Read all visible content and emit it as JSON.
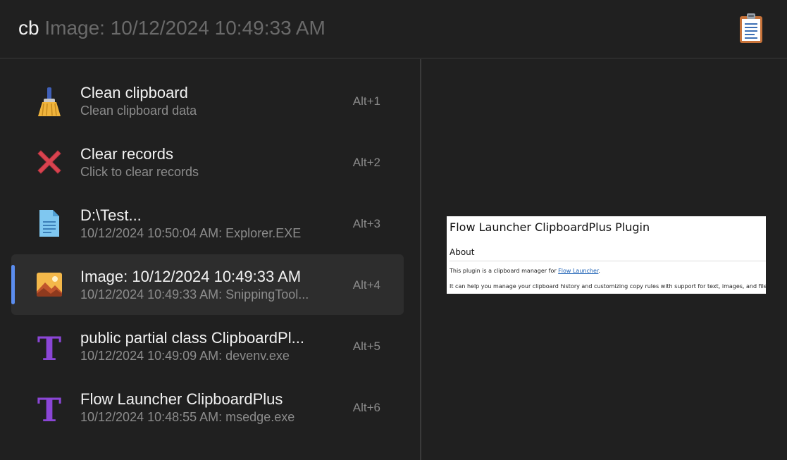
{
  "search": {
    "query": "cb",
    "suggestion": " Image: 10/12/2024 10:49:33 AM"
  },
  "plugin": {
    "icon": "clipboard-icon"
  },
  "results": [
    {
      "title": "Clean clipboard",
      "subtitle": "Clean clipboard data",
      "hotkey": "Alt+1",
      "icon": "broom-icon"
    },
    {
      "title": "Clear records",
      "subtitle": "Click to clear records",
      "hotkey": "Alt+2",
      "icon": "red-x-icon"
    },
    {
      "title": "D:\\Test...",
      "subtitle": "10/12/2024 10:50:04 AM: Explorer.EXE",
      "hotkey": "Alt+3",
      "icon": "file-icon"
    },
    {
      "title": "Image: 10/12/2024 10:49:33 AM",
      "subtitle": "10/12/2024 10:49:33 AM: SnippingTool...",
      "hotkey": "Alt+4",
      "icon": "image-icon",
      "selected": true
    },
    {
      "title": "public partial class ClipboardPl...",
      "subtitle": "10/12/2024 10:49:09 AM: devenv.exe",
      "hotkey": "Alt+5",
      "icon": "text-t-icon"
    },
    {
      "title": "Flow Launcher ClipboardPlus",
      "subtitle": "10/12/2024 10:48:55 AM: msedge.exe",
      "hotkey": "Alt+6",
      "icon": "text-t-icon"
    }
  ],
  "preview": {
    "title": "Flow Launcher ClipboardPlus Plugin",
    "heading": "About",
    "line1_prefix": "This plugin is a clipboard manager for ",
    "line1_link": "Flow Launcher",
    "line1_suffix": ".",
    "line2": "It can help you manage your clipboard history and customizing copy rules with support for text, images, and files."
  },
  "colors": {
    "background": "#202020",
    "selected_row": "#2d2d2d",
    "accent": "#5b8def",
    "text_primary": "#f2f2f2",
    "text_secondary": "#8c8c8c"
  }
}
